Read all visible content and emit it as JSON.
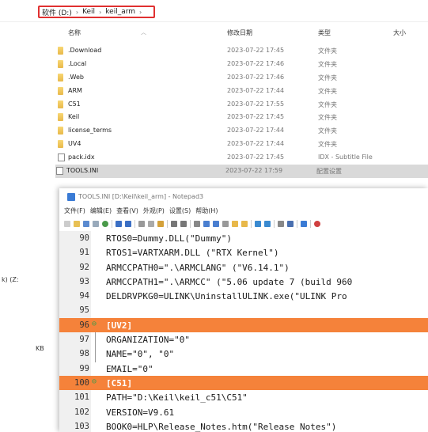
{
  "breadcrumb": {
    "items": [
      "软件 (D:)",
      "Keil",
      "keil_arm"
    ],
    "separator": "›"
  },
  "columns": {
    "name": "名称",
    "date": "修改日期",
    "type": "类型",
    "size": "大小"
  },
  "files": [
    {
      "name": ".Download",
      "date": "2023-07-22 17:45",
      "type": "文件夹",
      "kind": "folder"
    },
    {
      "name": ".Local",
      "date": "2023-07-22 17:46",
      "type": "文件夹",
      "kind": "folder"
    },
    {
      "name": ".Web",
      "date": "2023-07-22 17:46",
      "type": "文件夹",
      "kind": "folder"
    },
    {
      "name": "ARM",
      "date": "2023-07-22 17:44",
      "type": "文件夹",
      "kind": "folder"
    },
    {
      "name": "C51",
      "date": "2023-07-22 17:55",
      "type": "文件夹",
      "kind": "folder"
    },
    {
      "name": "Keil",
      "date": "2023-07-22 17:45",
      "type": "文件夹",
      "kind": "folder"
    },
    {
      "name": "license_terms",
      "date": "2023-07-22 17:44",
      "type": "文件夹",
      "kind": "folder"
    },
    {
      "name": "UV4",
      "date": "2023-07-22 17:44",
      "type": "文件夹",
      "kind": "folder"
    },
    {
      "name": "pack.idx",
      "date": "2023-07-22 17:45",
      "type": "IDX - Subtitle File",
      "kind": "file"
    },
    {
      "name": "TOOLS.INI",
      "date": "2023-07-22 17:59",
      "type": "配置设置",
      "kind": "file",
      "selected": true
    }
  ],
  "left_ghosts": [
    "k) (Z:",
    "KB"
  ],
  "notepad": {
    "title": "TOOLS.INI [D:\\Keil\\keil_arm] - Notepad3",
    "menu": [
      "文件(F)",
      "编辑(E)",
      "查看(V)",
      "外观(P)",
      "设置(S)",
      "帮助(H)"
    ],
    "lines": [
      {
        "num": "90",
        "text": "RTOS0=Dummy.DLL(\"Dummy\")"
      },
      {
        "num": "91",
        "text": "RTOS1=VARTXARM.DLL (\"RTX Kernel\")"
      },
      {
        "num": "92",
        "text": "ARMCCPATH0=\".\\ARMCLANG\" (\"V6.14.1\")"
      },
      {
        "num": "93",
        "text": "ARMCCPATH1=\".\\ARMCC\" (\"5.06 update 7 (build 960"
      },
      {
        "num": "94",
        "text": "DELDRVPKG0=ULINK\\UninstallULINK.exe(\"ULINK Pro"
      },
      {
        "num": "95",
        "text": ""
      },
      {
        "num": "96",
        "text": "[UV2]",
        "section": true
      },
      {
        "num": "97",
        "text": "ORGANIZATION=\"0\""
      },
      {
        "num": "98",
        "text": "NAME=\"0\", \"0\""
      },
      {
        "num": "99",
        "text": "EMAIL=\"0\""
      },
      {
        "num": "100",
        "text": "[C51]",
        "section": true
      },
      {
        "num": "101",
        "text": "PATH=\"D:\\Keil\\keil_c51\\C51\""
      },
      {
        "num": "102",
        "text": "VERSION=V9.61"
      },
      {
        "num": "103",
        "text": "BOOK0=HLP\\Release_Notes.htm(\"Release Notes\")"
      }
    ]
  },
  "colors": {
    "section_highlight": "#f5823a",
    "selection": "#d9d9d9",
    "breadcrumb_outline": "#e03030"
  }
}
